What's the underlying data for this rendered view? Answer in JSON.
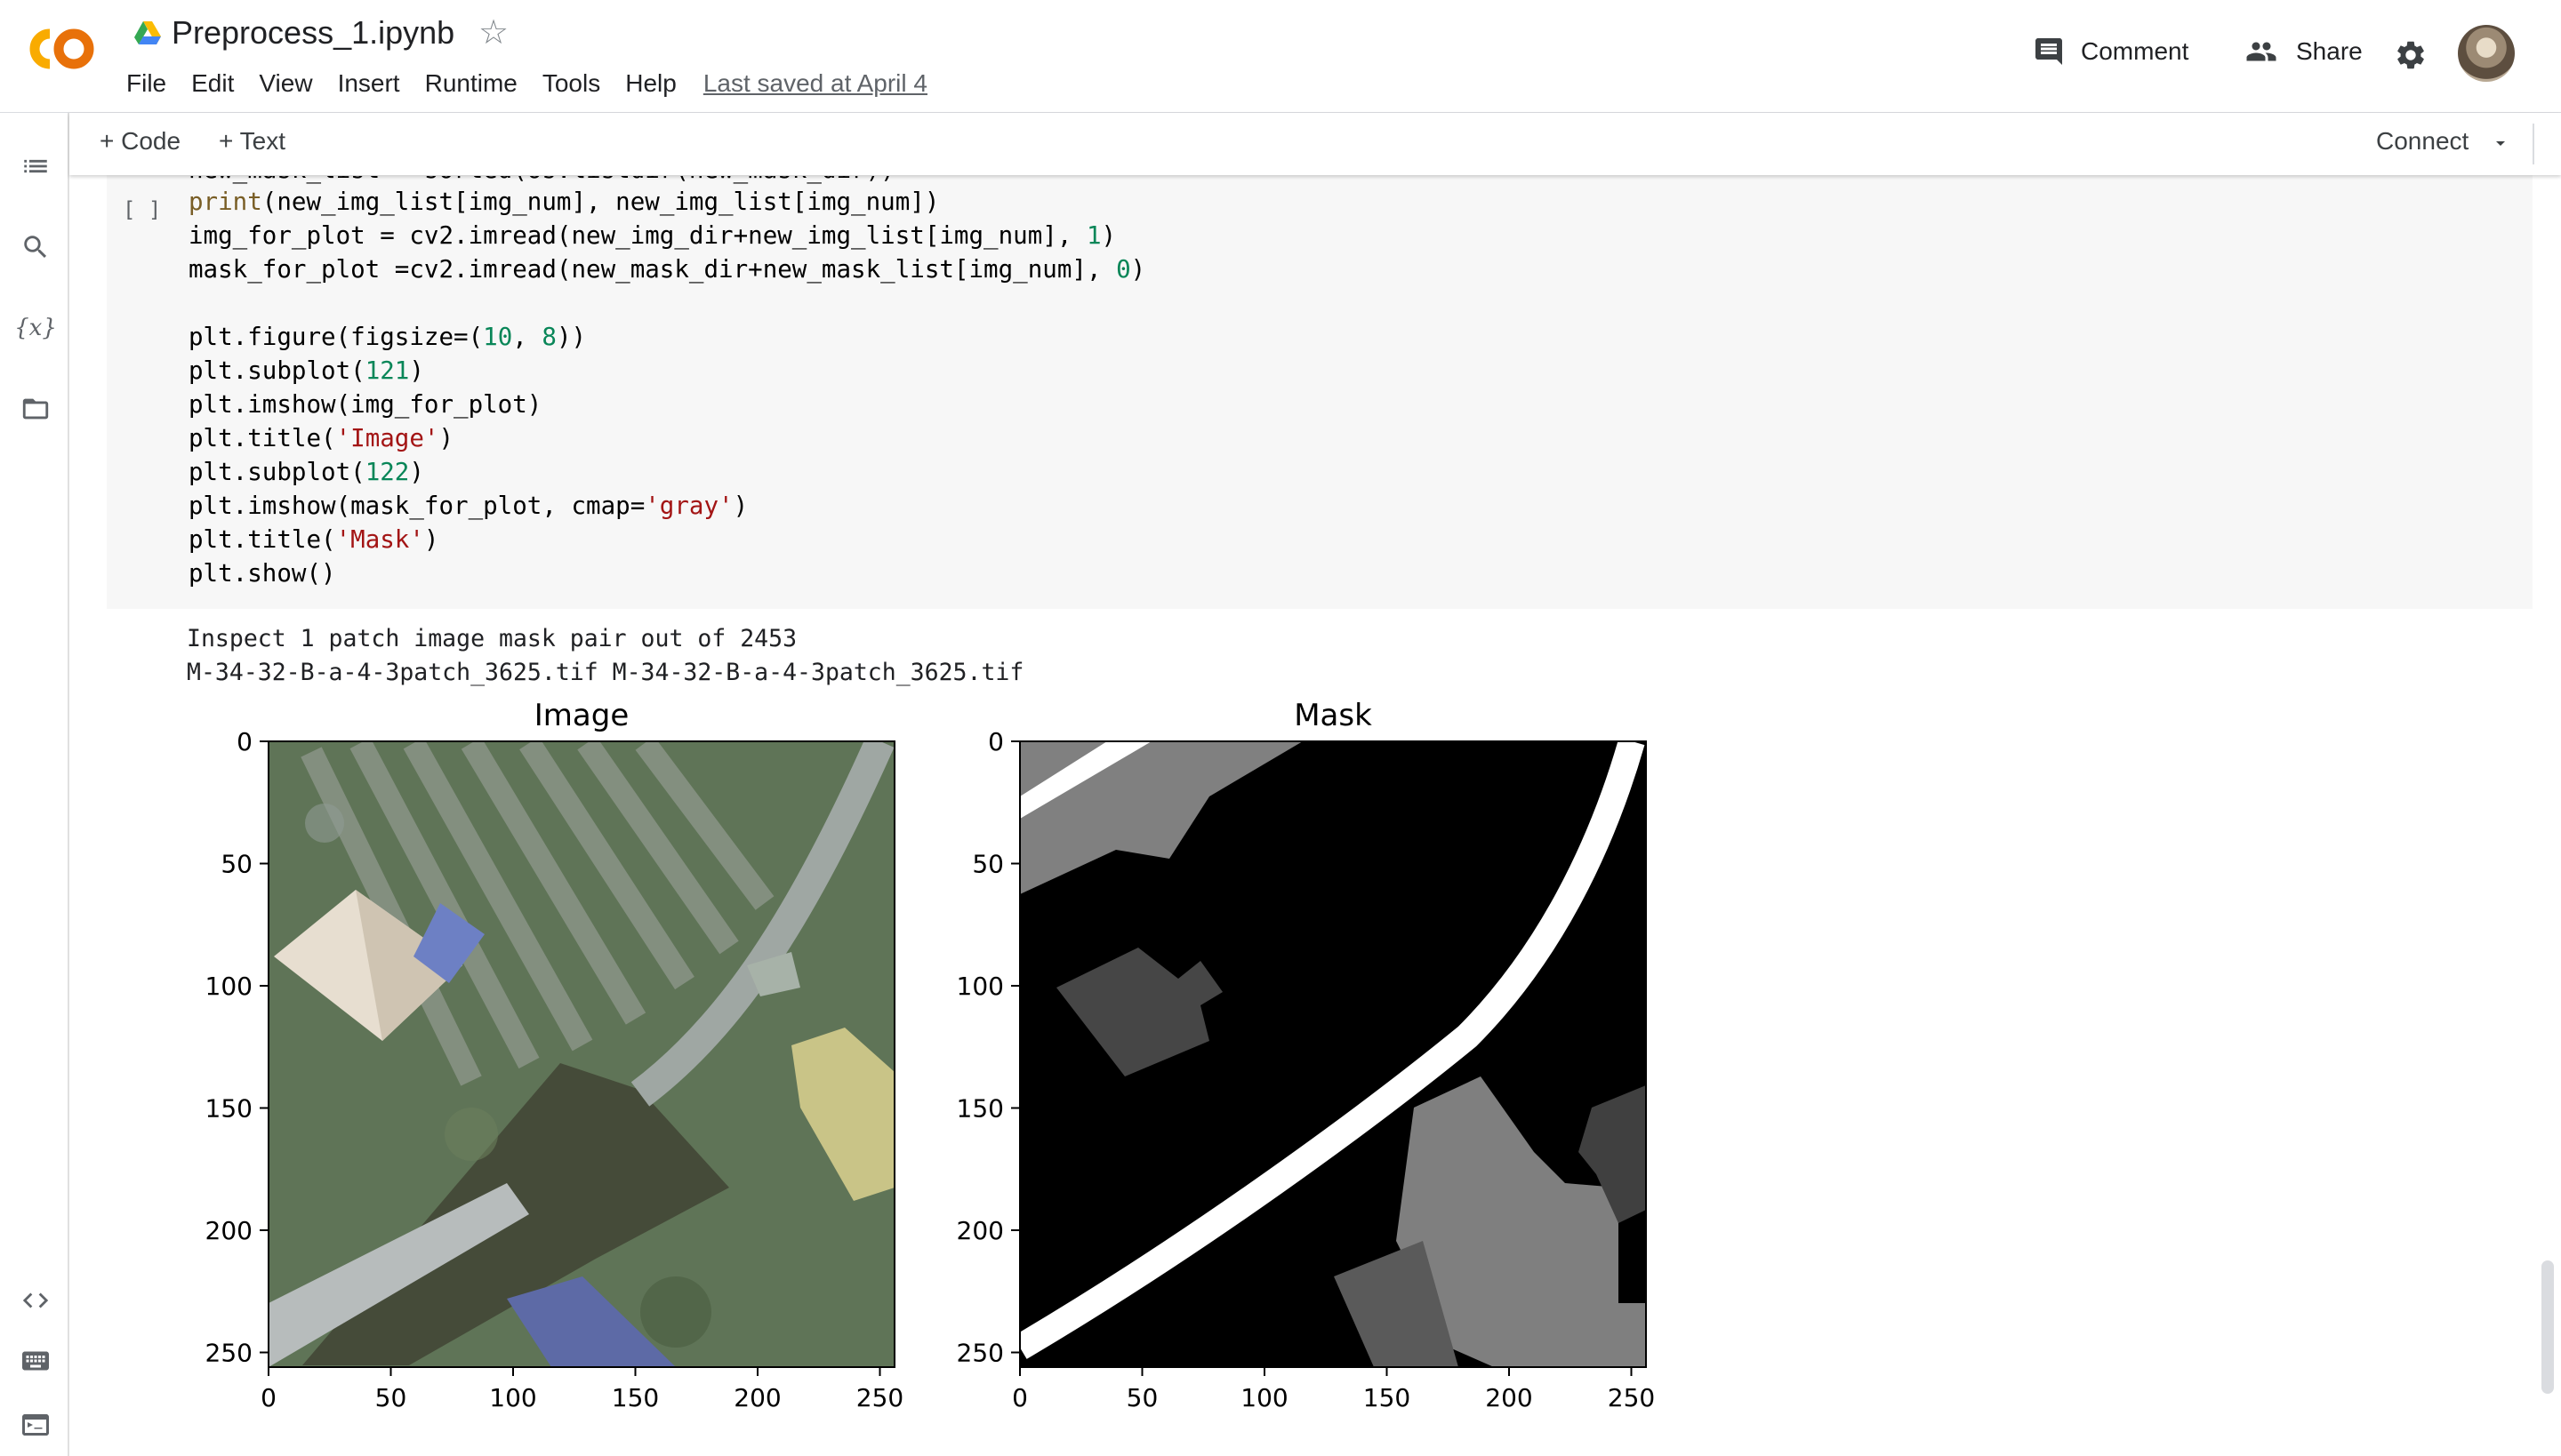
{
  "notebook": {
    "title": "Preprocess_1.ipynb",
    "last_saved": "Last saved at April 4"
  },
  "menu": [
    "File",
    "Edit",
    "View",
    "Insert",
    "Runtime",
    "Tools",
    "Help"
  ],
  "header": {
    "comment_label": "Comment",
    "share_label": "Share"
  },
  "toolbar": {
    "add_code": "+ Code",
    "add_text": "+ Text",
    "connect": "Connect"
  },
  "cell": {
    "run_indicator": "[ ]",
    "partial_line": "new_mask_list = sorted(os.listdir(new_mask_dir))",
    "code_lines": [
      [
        [
          "kw",
          "print"
        ],
        [
          "p",
          "(new_img_list[img_num], new_img_list[img_num])"
        ]
      ],
      [
        [
          "p",
          "img_for_plot = cv2.imread(new_img_dir+new_img_list[img_num], "
        ],
        [
          "num",
          "1"
        ],
        [
          "p",
          ")"
        ]
      ],
      [
        [
          "p",
          "mask_for_plot =cv2.imread(new_mask_dir+new_mask_list[img_num], "
        ],
        [
          "num",
          "0"
        ],
        [
          "p",
          ")"
        ]
      ],
      [
        [
          "p",
          ""
        ]
      ],
      [
        [
          "p",
          "plt.figure(figsize=("
        ],
        [
          "num",
          "10"
        ],
        [
          "p",
          ", "
        ],
        [
          "num",
          "8"
        ],
        [
          "p",
          "))"
        ]
      ],
      [
        [
          "p",
          "plt.subplot("
        ],
        [
          "num",
          "121"
        ],
        [
          "p",
          ")"
        ]
      ],
      [
        [
          "p",
          "plt.imshow(img_for_plot)"
        ]
      ],
      [
        [
          "p",
          "plt.title("
        ],
        [
          "str",
          "'Image'"
        ],
        [
          "p",
          ")"
        ]
      ],
      [
        [
          "p",
          "plt.subplot("
        ],
        [
          "num",
          "122"
        ],
        [
          "p",
          ")"
        ]
      ],
      [
        [
          "p",
          "plt.imshow(mask_for_plot, cmap="
        ],
        [
          "str",
          "'gray'"
        ],
        [
          "p",
          ")"
        ]
      ],
      [
        [
          "p",
          "plt.title("
        ],
        [
          "str",
          "'Mask'"
        ],
        [
          "p",
          ")"
        ]
      ],
      [
        [
          "p",
          "plt.show()"
        ]
      ]
    ]
  },
  "output": {
    "line1": "Inspect 1 patch image mask pair out of 2453",
    "line2": "M-34-32-B-a-4-3patch_3625.tif M-34-32-B-a-4-3patch_3625.tif"
  },
  "plots": [
    {
      "title": "Image",
      "type": "image",
      "xticks": [
        0,
        50,
        100,
        150,
        200,
        250
      ],
      "yticks": [
        0,
        50,
        100,
        150,
        200,
        250
      ],
      "xlim": [
        0,
        256
      ],
      "ylim": [
        0,
        256
      ]
    },
    {
      "title": "Mask",
      "type": "image",
      "cmap": "gray",
      "xticks": [
        0,
        50,
        100,
        150,
        200,
        250
      ],
      "yticks": [
        0,
        50,
        100,
        150,
        200,
        250
      ],
      "xlim": [
        0,
        256
      ],
      "ylim": [
        0,
        256
      ]
    }
  ]
}
